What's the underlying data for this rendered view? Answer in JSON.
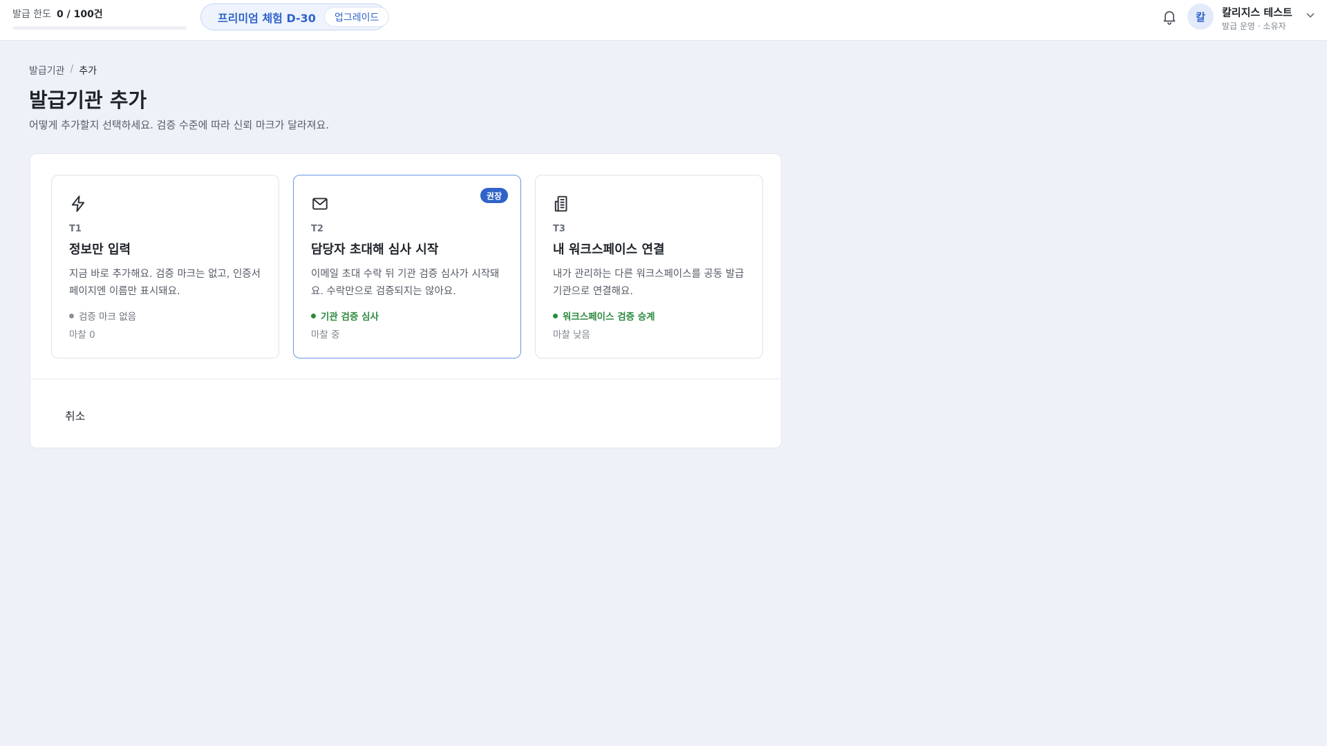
{
  "topbar": {
    "quota": {
      "label": "발급 한도",
      "value": "0 / 100건",
      "used_fraction": 0.0
    },
    "trial": {
      "label": "프리미엄 체험 D-30",
      "upgrade_label": "업그레이드",
      "icon": "sparkle-icon"
    },
    "notification_icon": "bell-icon",
    "user": {
      "avatar_initial": "칼",
      "name": "칼리지스 테스트",
      "role": "발급 운영 · 소유자"
    }
  },
  "breadcrumb": {
    "parent": "발급기관",
    "separator": "/",
    "current": "추가"
  },
  "page": {
    "title": "발급기관 추가",
    "description": "어떻게 추가할지 선택하세요. 검증 수준에 따라 신뢰 마크가 달라져요."
  },
  "options": [
    {
      "icon": "lightning-icon",
      "tier": "T1",
      "title": "정보만 입력",
      "description": "지금 바로 추가해요. 검증 마크는 없고, 인증서 페이지엔 이름만 표시돼요.",
      "status": "검증 마크 없음",
      "status_tone": "neutral",
      "mark": "마찰 0",
      "badge": ""
    },
    {
      "icon": "mail-icon",
      "tier": "T2",
      "title": "담당자 초대해 심사 시작",
      "description": "이메일 초대 수락 뒤 기관 검증 심사가 시작돼요. 수락만으로 검증되지는 않아요.",
      "status": "기관 검증 심사",
      "status_tone": "good",
      "mark": "마찰 중",
      "badge": "권장"
    },
    {
      "icon": "building-icon",
      "tier": "T3",
      "title": "내 워크스페이스 연결",
      "description": "내가 관리하는 다른 워크스페이스를 공동 발급기관으로 연결해요.",
      "status": "워크스페이스 검증 승계",
      "status_tone": "good",
      "mark": "마찰 낮음",
      "badge": ""
    }
  ],
  "actions": {
    "cancel_label": "취소"
  },
  "colors": {
    "accent": "#2f63c9",
    "success": "#2c8a3e",
    "background": "#eef1f8"
  }
}
